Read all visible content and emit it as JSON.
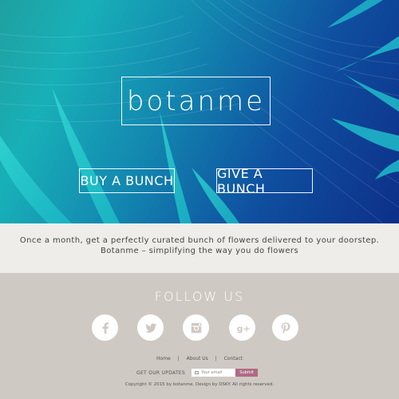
{
  "hero": {
    "brand": "botanme",
    "buy_label": "BUY A BUNCH",
    "give_label": "GIVE A BUNCH"
  },
  "tagline": {
    "line1": "Once a month, get a perfectly curated bunch of flowers delivered to your doorstep.",
    "line2": "Botanme – simplifying the way you do flowers"
  },
  "footer": {
    "follow_title": "FOLLOW  US",
    "social": [
      {
        "icon": "facebook-icon"
      },
      {
        "icon": "twitter-icon"
      },
      {
        "icon": "instagram-icon"
      },
      {
        "icon": "google-plus-icon"
      },
      {
        "icon": "pinterest-icon"
      }
    ],
    "links": [
      "Home",
      "About Us",
      "Contact"
    ],
    "separator": "|",
    "updates_label": "GET OUR UPDATES",
    "email_placeholder": "Your email",
    "submit_label": "Submit",
    "copyright": "Copyright © 2015 by botanme. Design by DSKY.   All rights reserved."
  },
  "colors": {
    "accent_submit": "#b06a85",
    "footer_bg": "#cfc9c3",
    "tagline_bg": "#efedea"
  }
}
